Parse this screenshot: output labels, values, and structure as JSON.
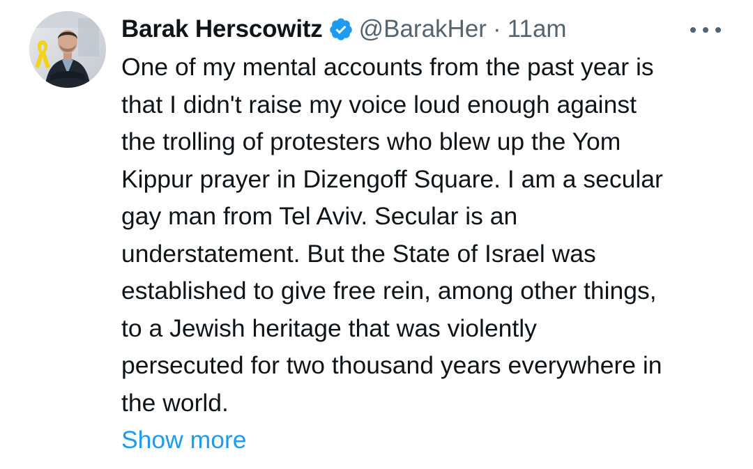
{
  "tweet": {
    "display_name": "Barak Herscowitz",
    "verified": true,
    "handle": "@BarakHer",
    "separator": "·",
    "time": "11am",
    "lines": [
      "One of my mental accounts from the past year is",
      "that I didn't raise my voice loud enough against",
      "the trolling of protesters who blew up the Yom",
      "Kippur prayer in Dizengoff Square. I am a secular",
      "gay man from Tel Aviv. Secular is an",
      "understatement. But the State of Israel was",
      "established to give free rein, among other things,",
      "to a Jewish heritage that was violently",
      "persecuted for two thousand years everywhere in",
      "the world."
    ],
    "show_more": "Show more"
  },
  "icons": {
    "verified": "verified-badge-icon",
    "more": "more-options-icon",
    "ribbon": "yellow-ribbon-icon"
  },
  "colors": {
    "text": "#0f1419",
    "secondary": "#536471",
    "link": "#1d9bf0",
    "verified": "#1d9bf0",
    "ribbon": "#f2d21b"
  }
}
